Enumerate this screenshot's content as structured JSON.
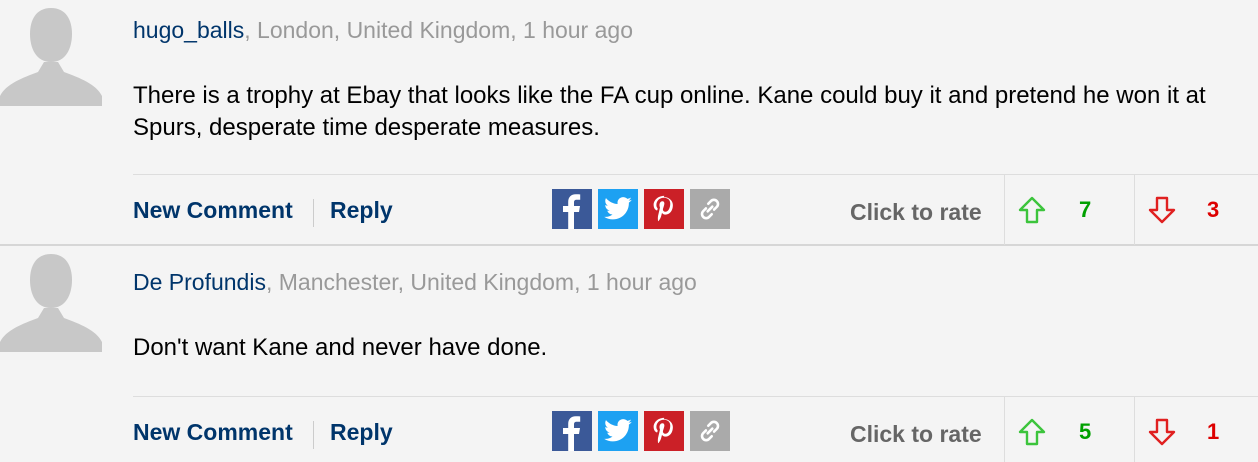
{
  "comments": [
    {
      "username": "hugo_balls",
      "location": ", London, United Kingdom, 1 hour ago",
      "text": "There is a trophy at Ebay that looks like the FA cup online. Kane could buy it and pretend he won it at Spurs, desperate time desperate measures.",
      "actions": {
        "new_comment": "New Comment",
        "reply": "Reply",
        "rate_label": "Click to rate"
      },
      "share_icons": [
        "facebook-icon",
        "twitter-icon",
        "pinterest-icon",
        "link-icon"
      ],
      "upvotes": "7",
      "downvotes": "3"
    },
    {
      "username": "De Profundis",
      "location": ", Manchester, United Kingdom, 1 hour ago",
      "text": "Don't want Kane and never have done.",
      "actions": {
        "new_comment": "New Comment",
        "reply": "Reply",
        "rate_label": "Click to rate"
      },
      "share_icons": [
        "facebook-icon",
        "twitter-icon",
        "pinterest-icon",
        "link-icon"
      ],
      "upvotes": "5",
      "downvotes": "1"
    }
  ],
  "colors": {
    "username": "#00356b",
    "meta": "#999999",
    "facebook": "#3b5998",
    "twitter": "#1da1f2",
    "pinterest": "#cb2027",
    "link": "#aaaaaa",
    "upvote": "#00a000",
    "downvote": "#dd0000"
  }
}
